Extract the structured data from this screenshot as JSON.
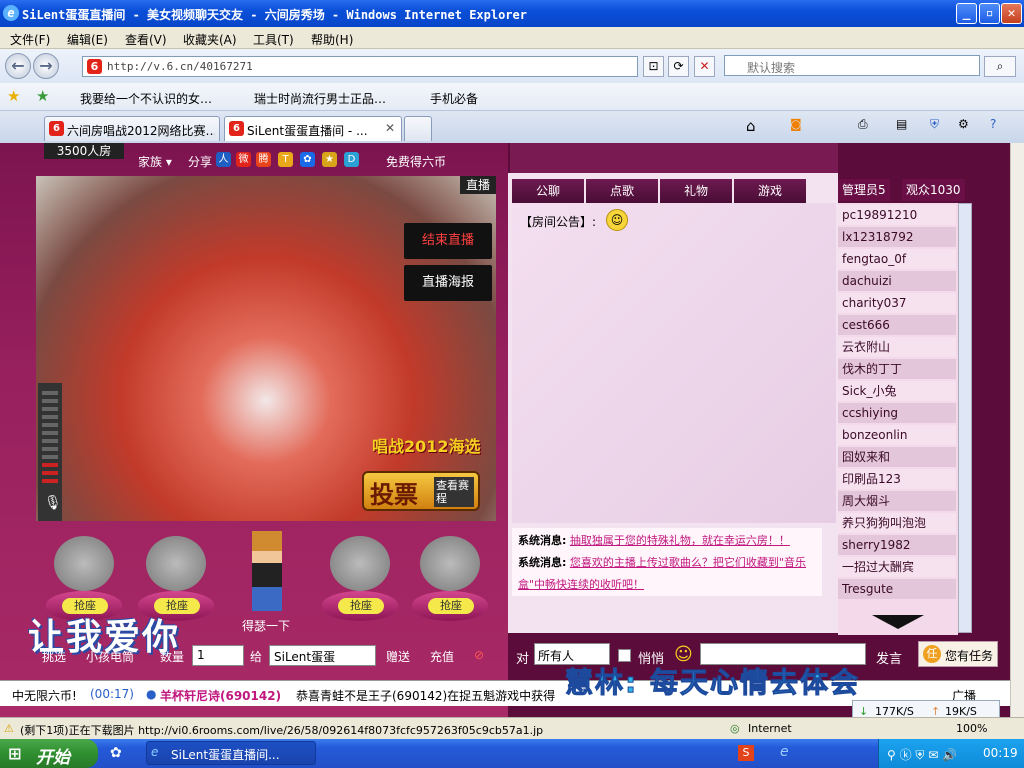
{
  "window": {
    "title": "SiLent蛋蛋直播间 - 美女视频聊天交友 - 六间房秀场 - Windows Internet Explorer"
  },
  "menu": [
    "文件(F)",
    "编辑(E)",
    "查看(V)",
    "收藏夹(A)",
    "工具(T)",
    "帮助(H)"
  ],
  "address": {
    "url": "http://v.6.cn/40167271",
    "search_placeholder": "默认搜索"
  },
  "favorites": [
    "我要给一个不认识的女…",
    "瑞士时尚流行男士正品…",
    "手机必备"
  ],
  "tabs": [
    {
      "label": "六间房唱战2012网络比赛…"
    },
    {
      "label": "SiLent蛋蛋直播间 - ..."
    }
  ],
  "room": {
    "people": "3500人房",
    "nav": {
      "family": "家族",
      "share": "分享",
      "free_coins": "免费得六币"
    },
    "video": {
      "live": "直播",
      "end_live": "结束直播",
      "poster": "直播海报"
    },
    "vote": {
      "event": "唱战2012海选",
      "vote": "投票",
      "view": "查看赛程"
    },
    "seats": [
      "抢座",
      "抢座",
      "抢座",
      "抢座"
    ],
    "dj": "得瑟一下",
    "big_text": "让我爱你",
    "gift": {
      "pick": "挑选",
      "item": "小孩电筒",
      "qty_label": "数量",
      "qty": "1",
      "to_label": "给",
      "to": "SiLent蛋蛋",
      "give": "赠送",
      "recharge": "充值"
    }
  },
  "chat": {
    "tabs": [
      "公聊",
      "点歌",
      "礼物",
      "游戏"
    ],
    "notice": "【房间公告】:",
    "system_msgs": [
      {
        "label": "系统消息:",
        "text": "抽取独属于您的特殊礼物，就在幸运六房！！"
      },
      {
        "label": "系统消息:",
        "text": "您喜欢的主播上传过歌曲么？把它们收藏到\"音乐盒\"中畅快连续的收听吧！"
      }
    ],
    "input": {
      "to_label": "对",
      "to": "所有人",
      "whisper": "悄悄",
      "send": "发言",
      "task": "您有任务"
    }
  },
  "users": {
    "admin_tab": "管理员5",
    "audience_tab": "观众1030",
    "list": [
      "pc19891210",
      "lx12318792",
      "fengtao_0f",
      "dachuizi",
      "charity037",
      "cest666",
      "云衣附山",
      "伐木的丁丁",
      "Sick_小兔",
      "ccshiying",
      "bonzeonlin",
      "囧奴来和",
      "印刷品123",
      "周大烟斗",
      "养只狗狗叫泡泡",
      "sherry1982",
      "一招过大酬宾",
      "Tresgute"
    ]
  },
  "ticker": {
    "time": "(00:17)",
    "lead": "中无限六币!",
    "user": "羊杯轩尼诗(690142)",
    "msg": "恭喜青蛙不是王子(690142)在捉五魁游戏中获得",
    "broadcast": "广播"
  },
  "overlay": "慧林: 每天心情去体会",
  "status": {
    "pending": "(剩下1项)正在下载图片 http://vi0.6rooms.com/live/26/58/092614f8073fcfc957263f05c9cb57a1.jp",
    "zone": "Internet",
    "zoom": "100%",
    "down": "177K/S",
    "up": "19K/S"
  },
  "taskbar": {
    "start": "开始",
    "task": "SiLent蛋蛋直播间...",
    "clock": "00:19"
  },
  "colors": {
    "accent": "#5c0c3a",
    "xp_blue": "#245ad8",
    "link": "#c0187e"
  }
}
